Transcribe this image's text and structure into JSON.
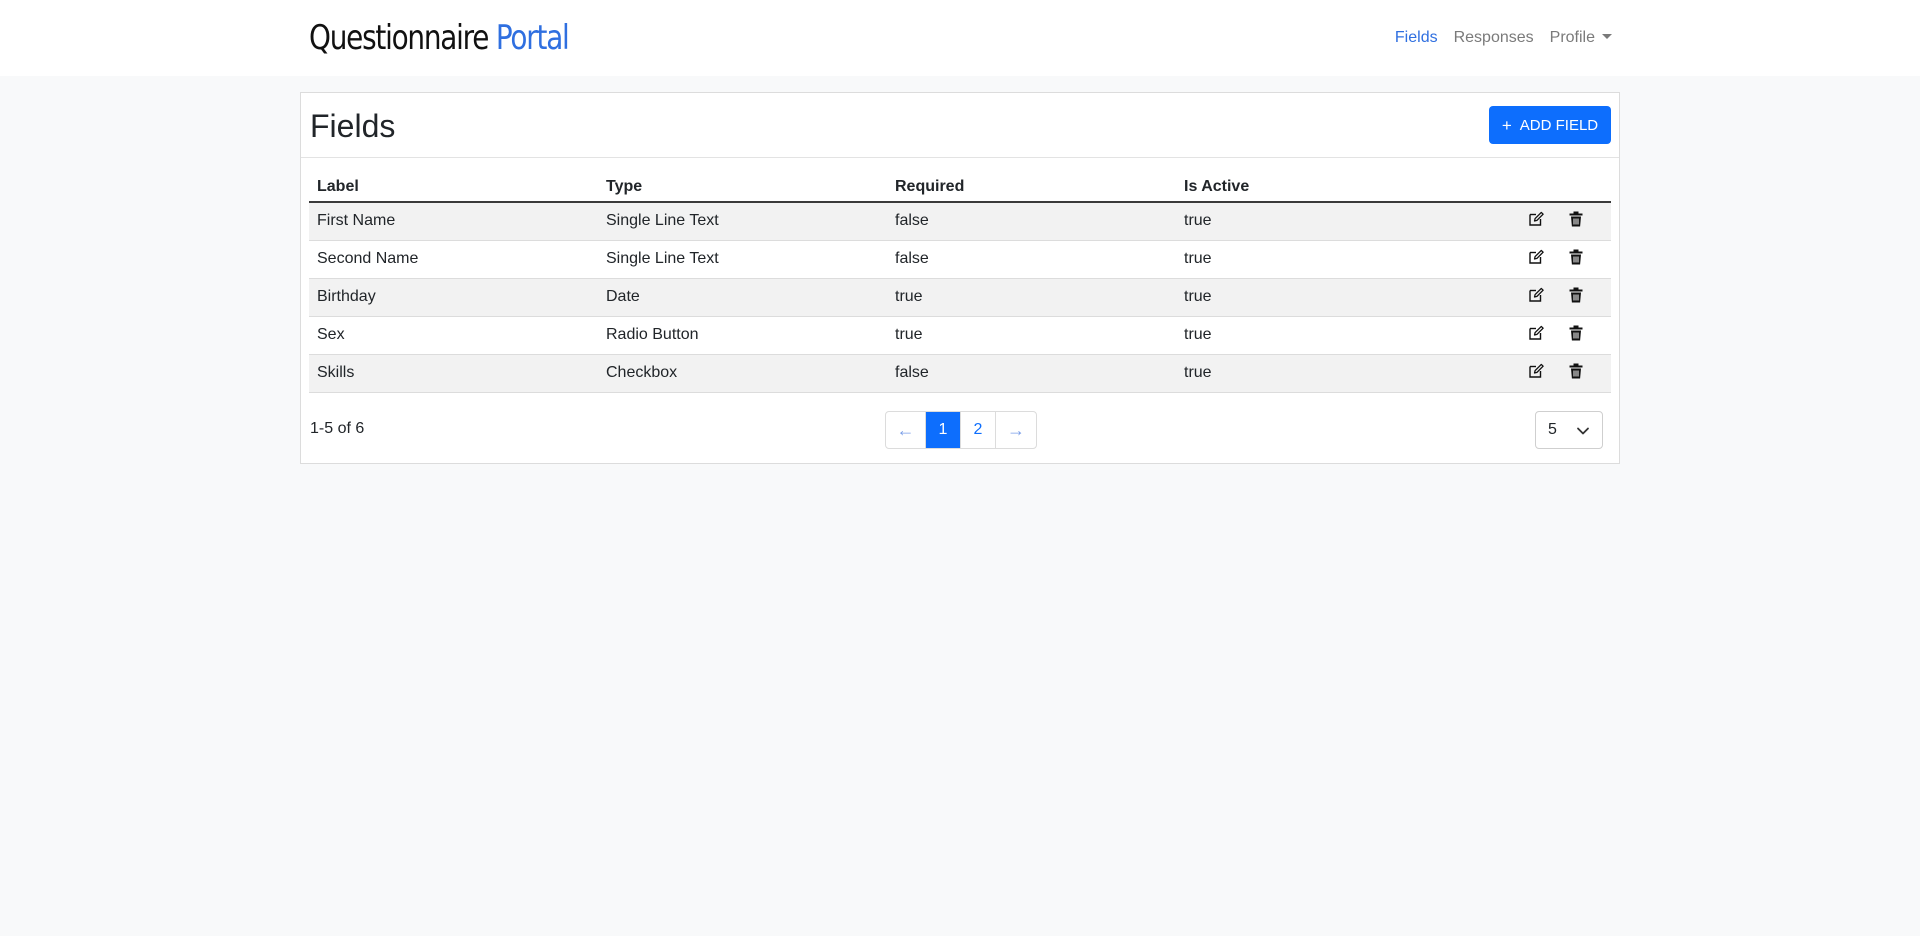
{
  "brand": {
    "part1": "Questionnaire ",
    "part2": "Portal"
  },
  "nav": {
    "fields": "Fields",
    "responses": "Responses",
    "profile": "Profile"
  },
  "page": {
    "title": "Fields",
    "add_button": "ADD FIELD",
    "add_icon": "+"
  },
  "table": {
    "headers": [
      "Label",
      "Type",
      "Required",
      "Is Active"
    ],
    "rows": [
      [
        "First Name",
        "Single Line Text",
        "false",
        "true"
      ],
      [
        "Second Name",
        "Single Line Text",
        "false",
        "true"
      ],
      [
        "Birthday",
        "Date",
        "true",
        "true"
      ],
      [
        "Sex",
        "Radio Button",
        "true",
        "true"
      ],
      [
        "Skills",
        "Checkbox",
        "false",
        "true"
      ]
    ]
  },
  "pagination": {
    "range": "1-5 of 6",
    "prev": "←",
    "pages": [
      "1",
      "2"
    ],
    "next": "→",
    "page_size": "5"
  },
  "colors": {
    "accent": "#0d6efd",
    "brand_blue": "#2f6fe0",
    "row_stripe": "#f2f2f2"
  },
  "icons": {
    "edit": "pencil-square-icon",
    "delete": "trash-icon",
    "select": "chevron-down-icon",
    "profile": "caret-down-icon"
  }
}
